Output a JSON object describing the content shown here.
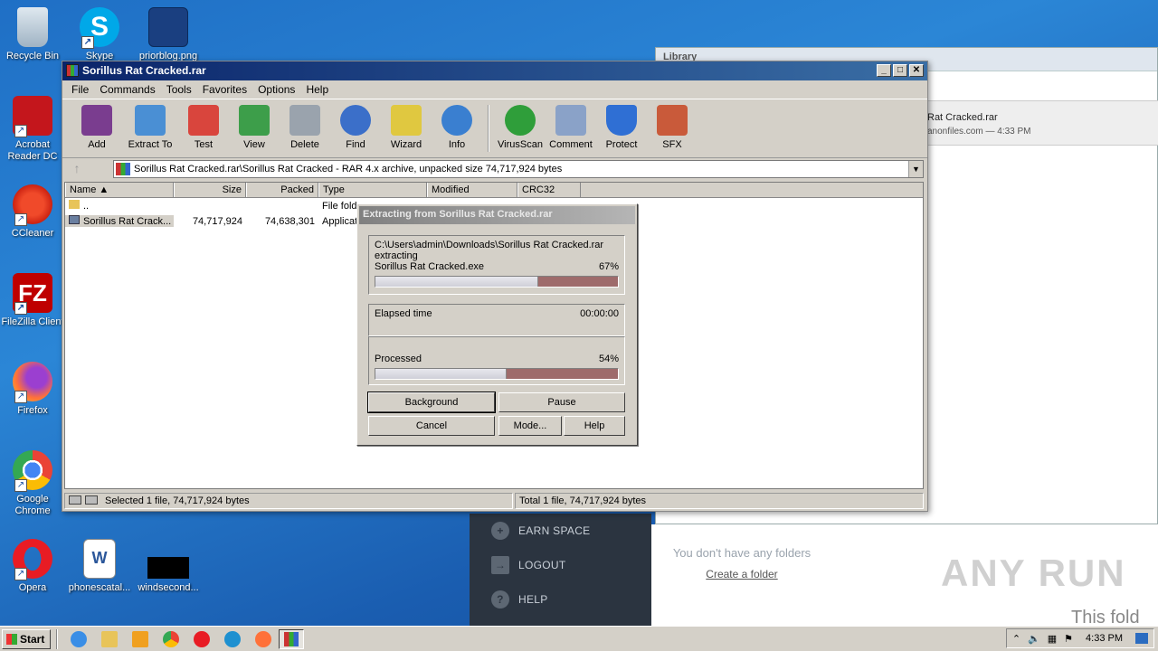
{
  "desktop": {
    "icons": [
      {
        "label": "Recycle Bin"
      },
      {
        "label": "Skype"
      },
      {
        "label": "priorblog.png"
      },
      {
        "label": "Acrobat Reader DC"
      },
      {
        "label": "CCleaner"
      },
      {
        "label": "FileZilla Client"
      },
      {
        "label": "Firefox"
      },
      {
        "label": "Google Chrome"
      },
      {
        "label": "Opera"
      },
      {
        "label": "phonescatal..."
      },
      {
        "label": "windsecond..."
      }
    ]
  },
  "browser": {
    "tab_title": "Library",
    "download_filename": "Rat Cracked.rar",
    "download_source": "anonfiles.com — 4:33 PM",
    "menu": [
      "EARN SPACE",
      "LOGOUT",
      "HELP"
    ],
    "no_folders": "You don't have any folders",
    "create_folder": "Create a folder",
    "this_folder": "This fold",
    "watermark": "ANY RUN"
  },
  "winrar": {
    "title": "Sorillus Rat Cracked.rar",
    "menu": [
      "File",
      "Commands",
      "Tools",
      "Favorites",
      "Options",
      "Help"
    ],
    "toolbar": [
      {
        "label": "Add",
        "color": "#7a3d8f"
      },
      {
        "label": "Extract To",
        "color": "#4a8fd4"
      },
      {
        "label": "Test",
        "color": "#d9453d"
      },
      {
        "label": "View",
        "color": "#3d9e4a"
      },
      {
        "label": "Delete",
        "color": "#9aa3ad"
      },
      {
        "label": "Find",
        "color": "#3b6fc9"
      },
      {
        "label": "Wizard",
        "color": "#e0c840"
      },
      {
        "label": "Info",
        "color": "#3a7fd0"
      },
      {
        "label": "VirusScan",
        "color": "#2f9e3a"
      },
      {
        "label": "Comment",
        "color": "#8aa2c8"
      },
      {
        "label": "Protect",
        "color": "#2f6fd4"
      },
      {
        "label": "SFX",
        "color": "#c95a3a"
      }
    ],
    "address": "Sorillus Rat Cracked.rar\\Sorillus Rat Cracked - RAR 4.x archive, unpacked size 74,717,924 bytes",
    "columns": [
      "Name",
      "Size",
      "Packed",
      "Type",
      "Modified",
      "CRC32"
    ],
    "rows": [
      {
        "name": "..",
        "size": "",
        "packed": "",
        "type": "File fold"
      },
      {
        "name": "Sorillus Rat Crack...",
        "size": "74,717,924",
        "packed": "74,638,301",
        "type": "Applicat"
      }
    ],
    "status_left": "Selected 1 file, 74,717,924 bytes",
    "status_right": "Total 1 file, 74,717,924 bytes"
  },
  "dialog": {
    "title": "Extracting from Sorillus Rat Cracked.rar",
    "path": "C:\\Users\\admin\\Downloads\\Sorillus Rat Cracked.rar",
    "action": "extracting",
    "file": "Sorillus Rat Cracked.exe",
    "file_percent": "67%",
    "file_progress": 0.67,
    "elapsed_label": "Elapsed time",
    "elapsed_value": "00:00:00",
    "processed_label": "Processed",
    "processed_percent": "54%",
    "processed_progress": 0.54,
    "buttons": {
      "background": "Background",
      "pause": "Pause",
      "cancel": "Cancel",
      "mode": "Mode...",
      "help": "Help"
    }
  },
  "taskbar": {
    "start": "Start",
    "clock": "4:33 PM"
  }
}
